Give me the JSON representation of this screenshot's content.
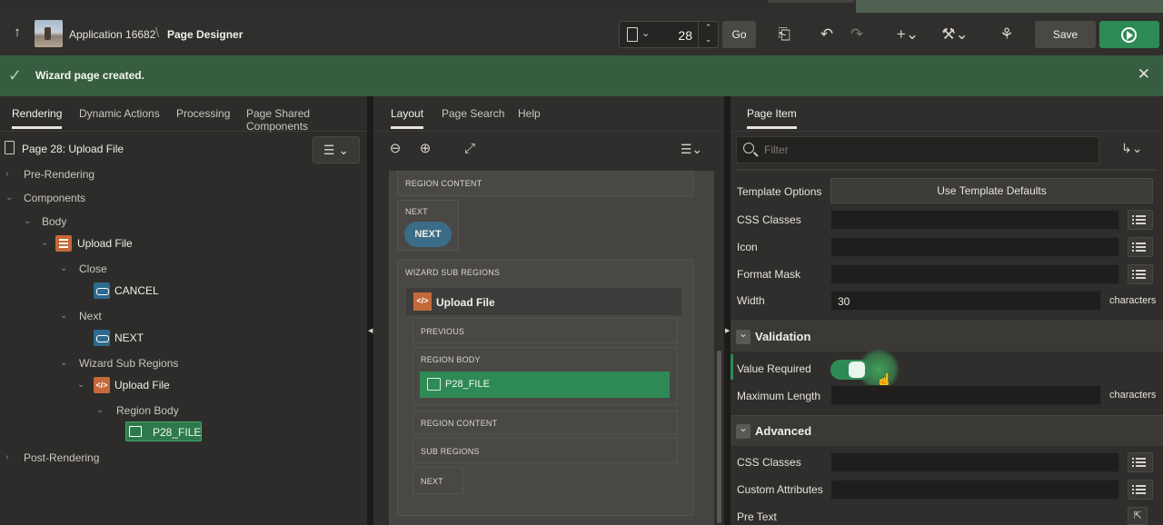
{
  "header": {
    "app": "Application 16682",
    "separator": "\\",
    "page_designer": "Page Designer",
    "page_number": "28",
    "go": "Go",
    "save": "Save"
  },
  "banner": {
    "message": "Wizard page created."
  },
  "left": {
    "tabs": [
      "Rendering",
      "Dynamic Actions",
      "Processing",
      "Page Shared Components"
    ],
    "root": "Page 28: Upload File",
    "tree": {
      "pre_rendering": "Pre-Rendering",
      "components": "Components",
      "body": "Body",
      "upload_file": "Upload File",
      "close": "Close",
      "cancel": "CANCEL",
      "next": "Next",
      "next_btn": "NEXT",
      "wizard_sub_regions": "Wizard Sub Regions",
      "sub_upload_file": "Upload File",
      "region_body": "Region Body",
      "p28_file": "P28_FILE",
      "post_rendering": "Post-Rendering"
    }
  },
  "middle": {
    "tabs": [
      "Layout",
      "Page Search",
      "Help"
    ],
    "region_content_top": "REGION CONTENT",
    "next_caption": "NEXT",
    "next_button": "NEXT",
    "wizard_sub_regions": "WIZARD SUB REGIONS",
    "upload_file": "Upload File",
    "previous": "PREVIOUS",
    "region_body": "REGION BODY",
    "p28_file": "P28_FILE",
    "region_content": "REGION CONTENT",
    "sub_regions": "SUB REGIONS",
    "next_bottom": "NEXT"
  },
  "right": {
    "tab": "Page Item",
    "filter_placeholder": "Filter",
    "template_options_label": "Template Options",
    "template_options_value": "Use Template Defaults",
    "css_classes_label": "CSS Classes",
    "icon_label": "Icon",
    "format_mask_label": "Format Mask",
    "width_label": "Width",
    "width_value": "30",
    "units": "characters",
    "validation_section": "Validation",
    "value_required_label": "Value Required",
    "max_length_label": "Maximum Length",
    "advanced_section": "Advanced",
    "adv_css_classes_label": "CSS Classes",
    "custom_attributes_label": "Custom Attributes",
    "pre_text_label": "Pre Text"
  },
  "colors": {
    "accent_green": "#2e8a55",
    "banner_green": "#365d3f",
    "button_blue": "#3b6c87",
    "region_orange": "#c46a3a"
  }
}
